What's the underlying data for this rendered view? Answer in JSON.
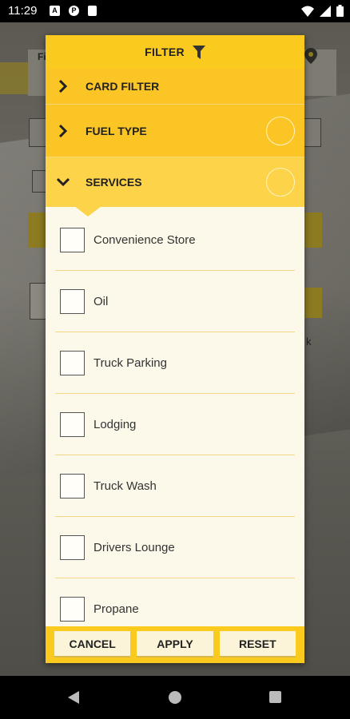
{
  "status": {
    "time": "11:29",
    "icons": [
      "a-box-icon",
      "p-circle-icon",
      "sd-card-icon"
    ],
    "right_icons": [
      "wifi-icon",
      "signal-icon",
      "battery-icon"
    ]
  },
  "background": {
    "left_label": "Fi",
    "right_label": "k"
  },
  "modal": {
    "title": "FILTER",
    "sections": {
      "card_filter": "CARD FILTER",
      "fuel_type": "FUEL TYPE",
      "services": "SERVICES"
    },
    "services": [
      "Convenience Store",
      "Oil",
      "Truck Parking",
      "Lodging",
      "Truck Wash",
      "Drivers Lounge",
      "Propane"
    ],
    "buttons": {
      "cancel": "CANCEL",
      "apply": "APPLY",
      "reset": "RESET"
    }
  },
  "colors": {
    "accent": "#fbca1f",
    "panel": "#fcf9ea"
  }
}
